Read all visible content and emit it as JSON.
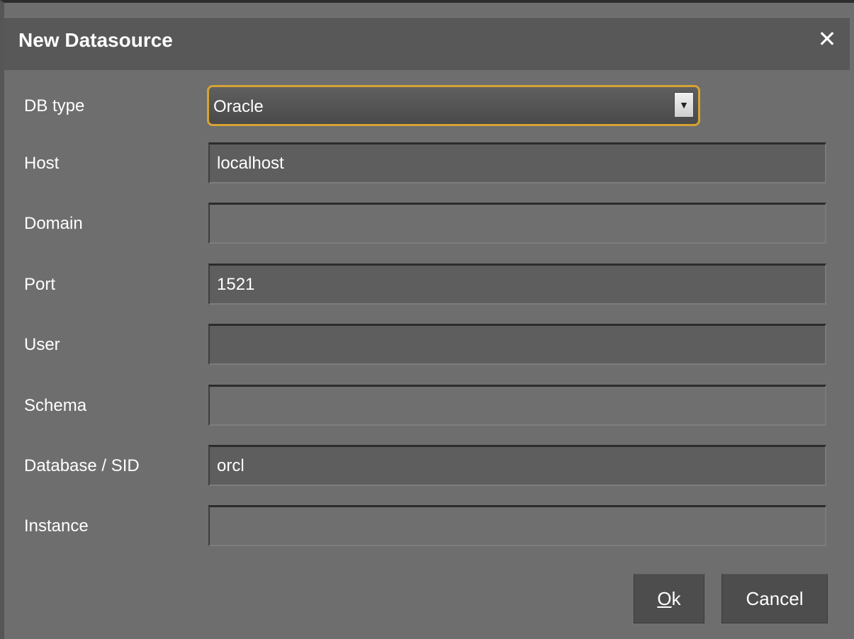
{
  "dialog": {
    "title": "New Datasource",
    "close_glyph": "✕"
  },
  "form": {
    "fields": [
      {
        "label": "DB type",
        "value": "Oracle",
        "type": "select",
        "arrow_glyph": "▼"
      },
      {
        "label": "Host",
        "value": "localhost",
        "type": "text"
      },
      {
        "label": "Domain",
        "value": "",
        "type": "text"
      },
      {
        "label": "Port",
        "value": "1521",
        "type": "text"
      },
      {
        "label": "User",
        "value": "",
        "type": "text"
      },
      {
        "label": "Schema",
        "value": "",
        "type": "text"
      },
      {
        "label": "Database / SID",
        "value": "orcl",
        "type": "text"
      },
      {
        "label": "Instance",
        "value": "",
        "type": "text"
      }
    ]
  },
  "buttons": {
    "ok_mnemonic": "O",
    "ok_rest": "k",
    "cancel_label": "Cancel"
  },
  "colors": {
    "focus_border": "#d6a234",
    "dialog_bg": "#6e6e6e",
    "titlebar_bg": "#585858"
  }
}
